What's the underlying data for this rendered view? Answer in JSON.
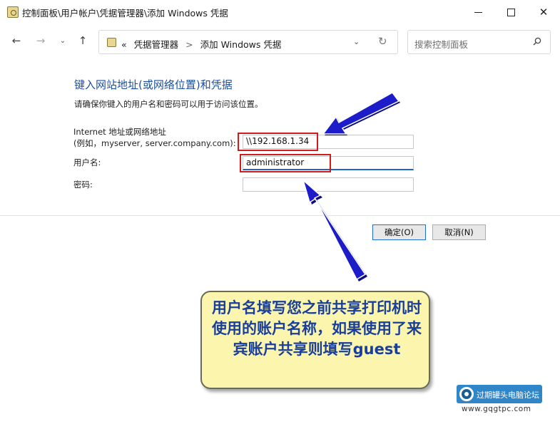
{
  "window": {
    "title": "控制面板\\用户帐户\\凭据管理器\\添加 Windows 凭据",
    "controls": {
      "minimize": "—",
      "close": "✕"
    }
  },
  "navbar": {
    "back": "←",
    "forward": "→",
    "recent": "⌄",
    "up": "↑",
    "breadcrumb": {
      "prefix": "«",
      "parent": "凭据管理器",
      "separator": ">",
      "current": "添加 Windows 凭据"
    },
    "dropdown": "⌄",
    "refresh": "↻",
    "search_placeholder": "搜索控制面板",
    "search_icon": "search-icon"
  },
  "form": {
    "heading": "键入网站地址(或网络位置)和凭据",
    "subtext": "请确保你键入的用户名和密码可以用于访问该位置。",
    "address_label_line1": "Internet 地址或网络地址",
    "address_label_line2": "(例如，myserver, server.company.com):",
    "address_value": "\\\\192.168.1.34",
    "username_label": "用户名:",
    "username_value": "administrator",
    "password_label": "密码:",
    "password_value": "",
    "ok_button": "确定(O)",
    "cancel_button": "取消(N)"
  },
  "annotation": {
    "callout_text": "用户名填写您之前共享打印机时使用的账户名称，如果使用了来宾账户共享则填写guest",
    "highlight_color": "#d21c1c",
    "arrow_color": "#1c1cc8"
  },
  "watermark": {
    "site_name": "过期罐头电脑论坛",
    "url": "www.gqgtpc.com"
  }
}
